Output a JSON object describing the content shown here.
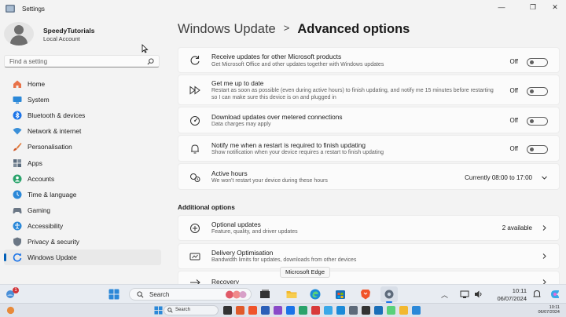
{
  "window": {
    "title": "Settings",
    "controls": {
      "minimize": "—",
      "maximize": "❐",
      "close": "✕"
    }
  },
  "profile": {
    "name": "SpeedyTutorials",
    "account_type": "Local Account"
  },
  "search": {
    "placeholder": "Find a setting"
  },
  "nav": {
    "items": [
      {
        "label": "Home",
        "icon": "home-icon",
        "color": "#e8734a"
      },
      {
        "label": "System",
        "icon": "system-icon",
        "color": "#2b88d8"
      },
      {
        "label": "Bluetooth & devices",
        "icon": "bluetooth-icon",
        "color": "#1a73e8"
      },
      {
        "label": "Network & internet",
        "icon": "wifi-icon",
        "color": "#3a8fd8"
      },
      {
        "label": "Personalisation",
        "icon": "brush-icon",
        "color": "#e07a3a"
      },
      {
        "label": "Apps",
        "icon": "apps-icon",
        "color": "#5a6b7d"
      },
      {
        "label": "Accounts",
        "icon": "accounts-icon",
        "color": "#2aa36b"
      },
      {
        "label": "Time & language",
        "icon": "globe-clock-icon",
        "color": "#2b88d8"
      },
      {
        "label": "Gaming",
        "icon": "gaming-icon",
        "color": "#6b7785"
      },
      {
        "label": "Accessibility",
        "icon": "accessibility-icon",
        "color": "#2b88d8"
      },
      {
        "label": "Privacy & security",
        "icon": "shield-icon",
        "color": "#6b7785"
      },
      {
        "label": "Windows Update",
        "icon": "windows-update-icon",
        "color": "#1a73e8",
        "active": true
      }
    ]
  },
  "breadcrumb": {
    "parent": "Windows Update",
    "separator": ">",
    "current": "Advanced options"
  },
  "settings": [
    {
      "title": "Receive updates for other Microsoft products",
      "description": "Get Microsoft Office and other updates together with Windows updates",
      "state": "Off",
      "icon": "refresh-icon"
    },
    {
      "title": "Get me up to date",
      "description": "Restart as soon as possible (even during active hours) to finish updating, and notify me 15 minutes before restarting so I can make sure this device is on and plugged in",
      "state": "Off",
      "icon": "fast-forward-icon"
    },
    {
      "title": "Download updates over metered connections",
      "description": "Data charges may apply",
      "state": "Off",
      "icon": "metered-connection-icon"
    },
    {
      "title": "Notify me when a restart is required to finish updating",
      "description": "Show notification when your device requires a restart to finish updating",
      "state": "Off",
      "icon": "bell-icon"
    }
  ],
  "active_hours": {
    "title": "Active hours",
    "description": "We won't restart your device during these hours",
    "value": "Currently 08:00 to 17:00",
    "icon": "active-hours-icon"
  },
  "additional": {
    "section_title": "Additional options",
    "items": [
      {
        "title": "Optional updates",
        "description": "Feature, quality, and driver updates",
        "value": "2 available",
        "icon": "plus-circle-icon"
      },
      {
        "title": "Delivery Optimisation",
        "description": "Bandwidth limits for updates, downloads from other devices",
        "value": "",
        "icon": "delivery-optimisation-icon"
      },
      {
        "title": "Recovery",
        "description": "",
        "value": "",
        "icon": "recovery-icon"
      }
    ]
  },
  "tooltip": {
    "text": "Microsoft Edge"
  },
  "taskbar": {
    "search_label": "Search",
    "clock_time": "10:11",
    "clock_date": "06/07/2024",
    "weather_badge": "1"
  },
  "host_taskbar": {
    "search_label": "Search",
    "clock_time": "10:11",
    "clock_date": "06/07/2024"
  }
}
